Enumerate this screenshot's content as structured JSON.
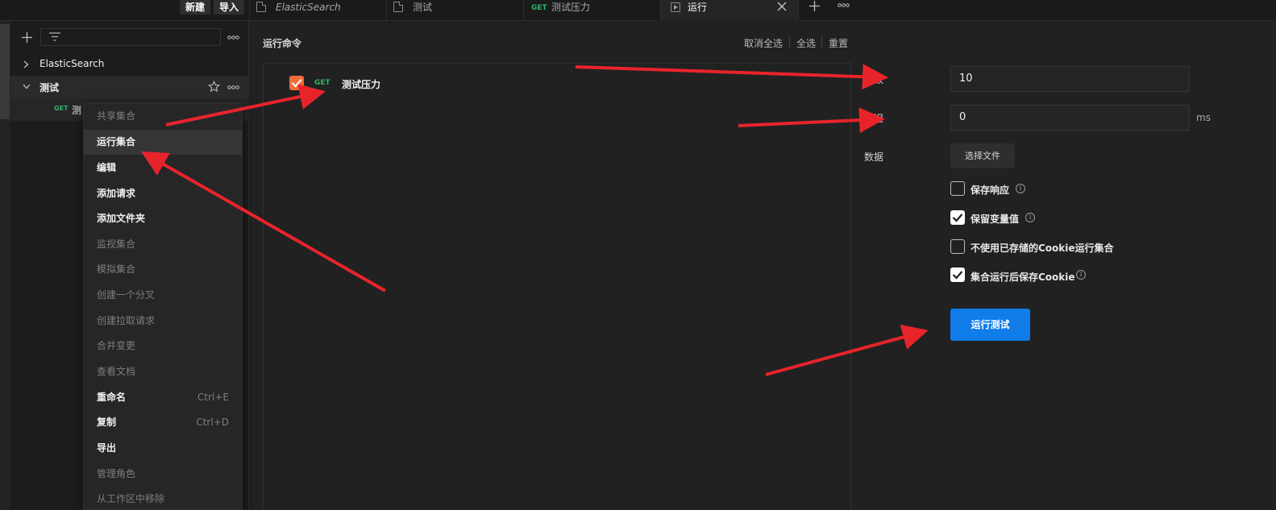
{
  "topbar": {
    "new_label": "新建",
    "import_label": "导入",
    "tabs": [
      {
        "label": "ElasticSearch",
        "icon": "document-icon"
      },
      {
        "label": "测试",
        "icon": "document-icon"
      },
      {
        "method": "GET",
        "label": "测试压力"
      },
      {
        "label": "运行",
        "icon": "runner-icon"
      }
    ]
  },
  "sidebar": {
    "tree": [
      {
        "label": "ElasticSearch"
      },
      {
        "label": "测试"
      },
      {
        "method": "GET",
        "label": "测"
      }
    ]
  },
  "context_menu": {
    "items": [
      {
        "label": "共享集合",
        "disabled": true
      },
      {
        "label": "运行集合",
        "disabled": false
      },
      {
        "label": "编辑",
        "disabled": false
      },
      {
        "label": "添加请求",
        "disabled": false
      },
      {
        "label": "添加文件夹",
        "disabled": false
      },
      {
        "label": "监视集合",
        "disabled": true
      },
      {
        "label": "模拟集合",
        "disabled": true
      },
      {
        "label": "创建一个分叉",
        "disabled": true
      },
      {
        "label": "创建拉取请求",
        "disabled": true
      },
      {
        "label": "合并变更",
        "disabled": true
      },
      {
        "label": "查看文档",
        "disabled": true
      },
      {
        "label": "重命名",
        "shortcut": "Ctrl+E",
        "disabled": false
      },
      {
        "label": "复制",
        "shortcut": "Ctrl+D",
        "disabled": false
      },
      {
        "label": "导出",
        "disabled": false
      },
      {
        "label": "管理角色",
        "disabled": true
      },
      {
        "label": "从工作区中移除",
        "disabled": true
      }
    ]
  },
  "runner": {
    "section_title": "运行命令",
    "deselect_all": "取消全选",
    "select_all": "全选",
    "reset": "重置",
    "requests": [
      {
        "method": "GET",
        "name": "测试压力",
        "checked": true
      }
    ],
    "iterations_label": "次数",
    "iterations_value": "10",
    "delay_label": "延迟",
    "delay_value": "0",
    "delay_unit": "ms",
    "data_label": "数据",
    "choose_file": "选择文件",
    "options": [
      {
        "label": "保存响应",
        "checked": false,
        "info": true
      },
      {
        "label": "保留变量值",
        "checked": true,
        "info": true
      },
      {
        "label": "不使用已存储的Cookie运行集合",
        "checked": false,
        "info": false
      },
      {
        "label": "集合运行后保存Cookie",
        "checked": true,
        "info": true
      }
    ],
    "run_button": "运行测试"
  },
  "colors": {
    "accent_blue": "#0f7ce8",
    "checkbox_orange": "#f26b3a",
    "get_green": "#2fb36a",
    "arrow_red": "#e8242b"
  }
}
